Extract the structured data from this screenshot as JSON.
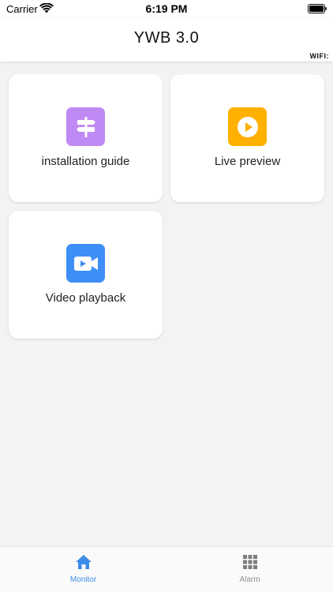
{
  "status_bar": {
    "carrier": "Carrier",
    "time": "6:19 PM",
    "wifi_icon": "wifi-signal-icon",
    "battery_icon": "battery-icon"
  },
  "nav": {
    "title": "YWB 3.0",
    "wifi_label": "WIFI:"
  },
  "tiles": [
    {
      "label": "installation guide",
      "icon": "signpost-icon",
      "color": "#c08af5"
    },
    {
      "label": "Live preview",
      "icon": "play-circle-icon",
      "color": "#ffb000"
    },
    {
      "label": "Video playback",
      "icon": "video-camera-icon",
      "color": "#3e8ef7"
    }
  ],
  "tab_bar": {
    "tabs": [
      {
        "label": "Monitor",
        "icon": "home-icon",
        "active": true
      },
      {
        "label": "Alarm",
        "icon": "grid-icon",
        "active": false
      }
    ],
    "active_color": "#3c8ce7",
    "inactive_color": "#8e8e93"
  },
  "colors": {
    "background": "#f3f3f3",
    "surface": "#ffffff"
  }
}
